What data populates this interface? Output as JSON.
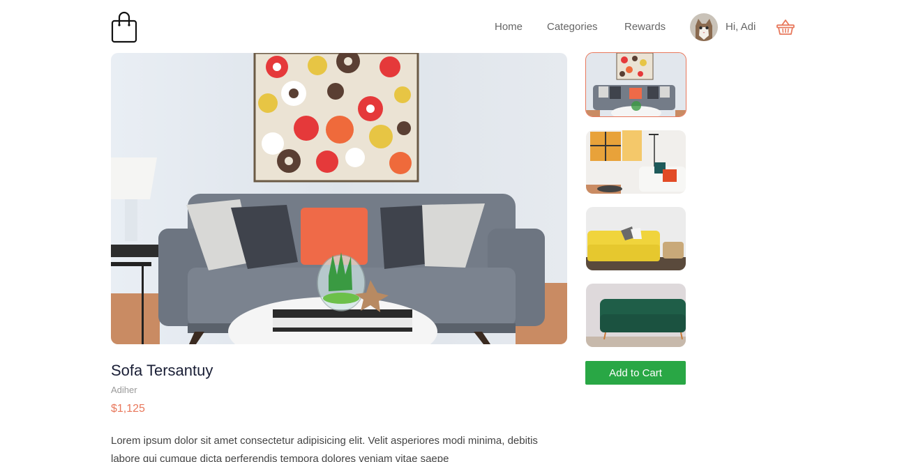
{
  "nav": {
    "home": "Home",
    "categories": "Categories",
    "rewards": "Rewards"
  },
  "user": {
    "greeting": "Hi, Adi"
  },
  "product": {
    "title": "Sofa Tersantuy",
    "brand": "Adiher",
    "price": "$1,125",
    "description": "Lorem ipsum dolor sit amet consectetur adipisicing elit. Velit asperiores modi minima, debitis labore qui cumque dicta perferendis tempora dolores veniam vitae saepe"
  },
  "actions": {
    "add_to_cart": "Add to Cart"
  },
  "colors": {
    "accent": "#e8775b",
    "button": "#29a745",
    "title": "#1a1f36"
  },
  "icons": {
    "logo": "shopping-bag-icon",
    "cart": "basket-icon"
  }
}
